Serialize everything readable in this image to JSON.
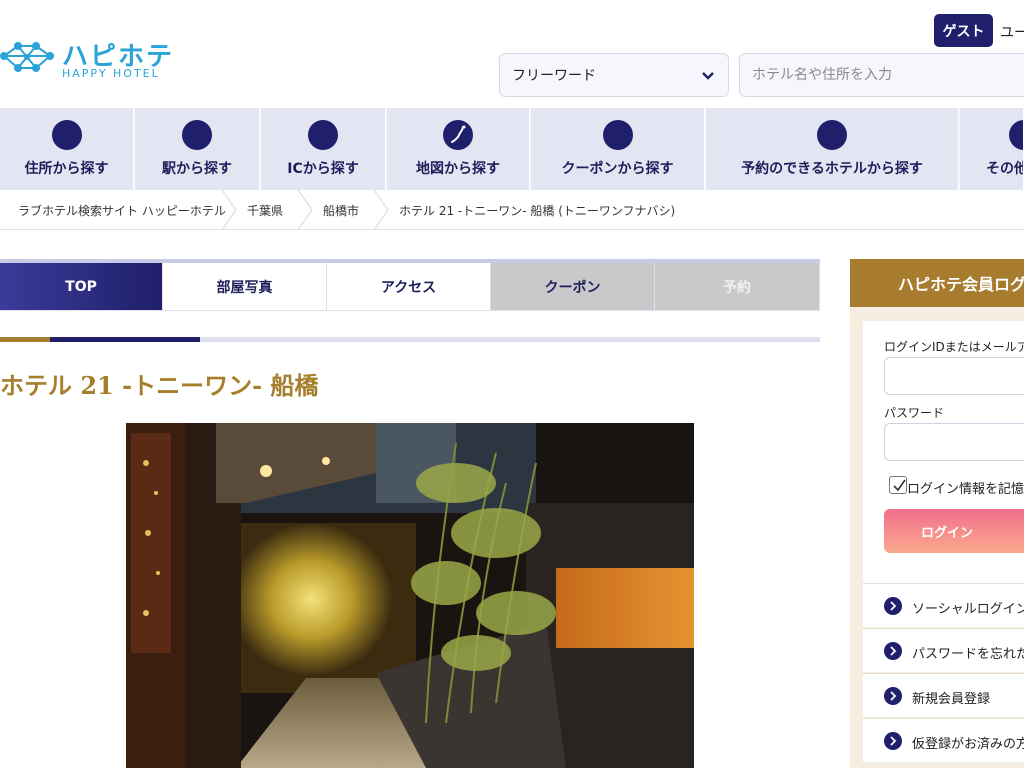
{
  "header": {
    "logo_jp": "ハピホテ",
    "logo_en": "HAPPY HOTEL",
    "guest_badge": "ゲスト",
    "user_text": "ユー",
    "search_mode": "フリーワード",
    "search_placeholder": "ホテル名や住所を入力"
  },
  "nav": {
    "items": [
      {
        "label": "住所から探す",
        "icon": "circle-icon"
      },
      {
        "label": "駅から探す",
        "icon": "circle-icon"
      },
      {
        "label": "ICから探す",
        "icon": "circle-icon"
      },
      {
        "label": "地図から探す",
        "icon": "japan-map-icon"
      },
      {
        "label": "クーポンから探す",
        "icon": "circle-icon"
      },
      {
        "label": "予約のできるホテルから探す",
        "icon": "circle-icon"
      },
      {
        "label": "その他",
        "icon": "circle-icon"
      }
    ]
  },
  "breadcrumb": [
    "ラブホテル検索サイト ハッピーホテル",
    "千葉県",
    "船橋市",
    "ホテル 21 -トニーワン- 船橋 (トニーワンフナバシ)"
  ],
  "tabs": [
    {
      "label": "TOP",
      "state": "active"
    },
    {
      "label": "部屋写真",
      "state": "normal"
    },
    {
      "label": "アクセス",
      "state": "normal"
    },
    {
      "label": "クーポン",
      "state": "grey"
    },
    {
      "label": "予約",
      "state": "disabled"
    }
  ],
  "hotel": {
    "title": "ホテル 21 -トニーワン- 船橋"
  },
  "login": {
    "header": "ハピホテ会員ログ",
    "id_label": "ログインIDまたはメールアドレ",
    "password_label": "パスワード",
    "remember_label": "ログイン情報を記憶す",
    "button": "ログイン",
    "links": [
      "ソーシャルログイン",
      "パスワードを忘れた方",
      "新規会員登録",
      "仮登録がお済みの方"
    ]
  },
  "colors": {
    "navy": "#1f1f6b",
    "gold": "#a57f2c",
    "logo_blue": "#2aa3d6",
    "nav_bg": "#e4e5f3"
  }
}
